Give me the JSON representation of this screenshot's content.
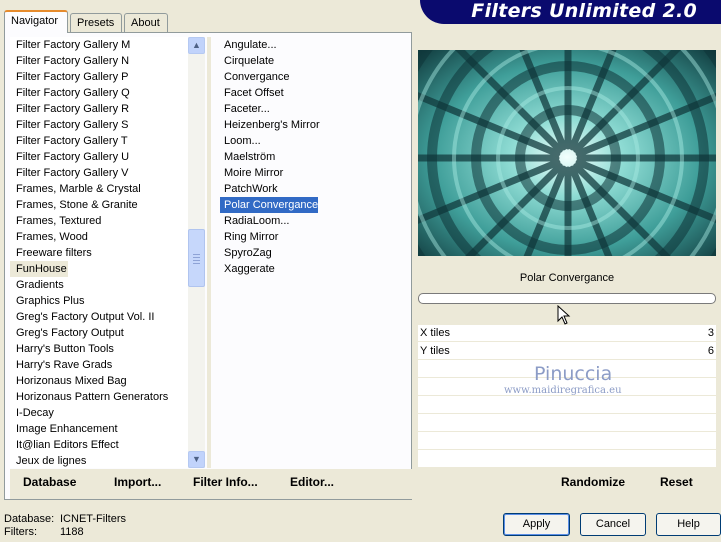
{
  "banner": {
    "title": "Filters Unlimited 2.0"
  },
  "tabs": [
    {
      "label": "Navigator"
    },
    {
      "label": "Presets"
    },
    {
      "label": "About"
    }
  ],
  "categories": [
    "Filter Factory Gallery M",
    "Filter Factory Gallery N",
    "Filter Factory Gallery P",
    "Filter Factory Gallery Q",
    "Filter Factory Gallery R",
    "Filter Factory Gallery S",
    "Filter Factory Gallery T",
    "Filter Factory Gallery U",
    "Filter Factory Gallery V",
    "Frames, Marble & Crystal",
    "Frames, Stone & Granite",
    "Frames, Textured",
    "Frames, Wood",
    "Freeware filters",
    "FunHouse",
    "Gradients",
    "Graphics Plus",
    "Greg's Factory Output Vol. II",
    "Greg's Factory Output",
    "Harry's Button Tools",
    "Harry's Rave Grads",
    "Horizonaus Mixed Bag",
    "Horizonaus Pattern Generators",
    "I-Decay",
    "Image Enhancement",
    "It@lian Editors Effect",
    "Jeux de lignes"
  ],
  "selected_category": "FunHouse",
  "filters": [
    "Angulate...",
    "Cirquelate",
    "Convergance",
    "Facet Offset",
    "Faceter...",
    "Heizenberg's Mirror",
    "Loom...",
    "Maelström",
    "Moire Mirror",
    "PatchWork",
    "Polar Convergance",
    "RadiaLoom...",
    "Ring Mirror",
    "SpyroZag",
    "Xaggerate"
  ],
  "selected_filter": "Polar Convergance",
  "left_buttons": {
    "database": "Database",
    "import": "Import...",
    "filter_info": "Filter Info...",
    "editor": "Editor..."
  },
  "preview": {
    "filter_name": "Polar Convergance",
    "progress": 0
  },
  "params": [
    {
      "label": "X tiles",
      "value": "3"
    },
    {
      "label": "Y tiles",
      "value": "6"
    }
  ],
  "watermark": {
    "name": "Pinuccia",
    "url": "www.maidiregrafica.eu"
  },
  "right_buttons": {
    "randomize": "Randomize",
    "reset": "Reset"
  },
  "status": {
    "database_label": "Database:",
    "database_value": "ICNET-Filters",
    "filters_label": "Filters:",
    "filters_value": "1188"
  },
  "dialog_buttons": {
    "apply": "Apply",
    "cancel": "Cancel",
    "help": "Help"
  },
  "colors": {
    "selection": "#316ac5",
    "banner": "#0a0a6e",
    "dialog_bg": "#ece9d8",
    "preview_teal": "#5fc1b9"
  }
}
